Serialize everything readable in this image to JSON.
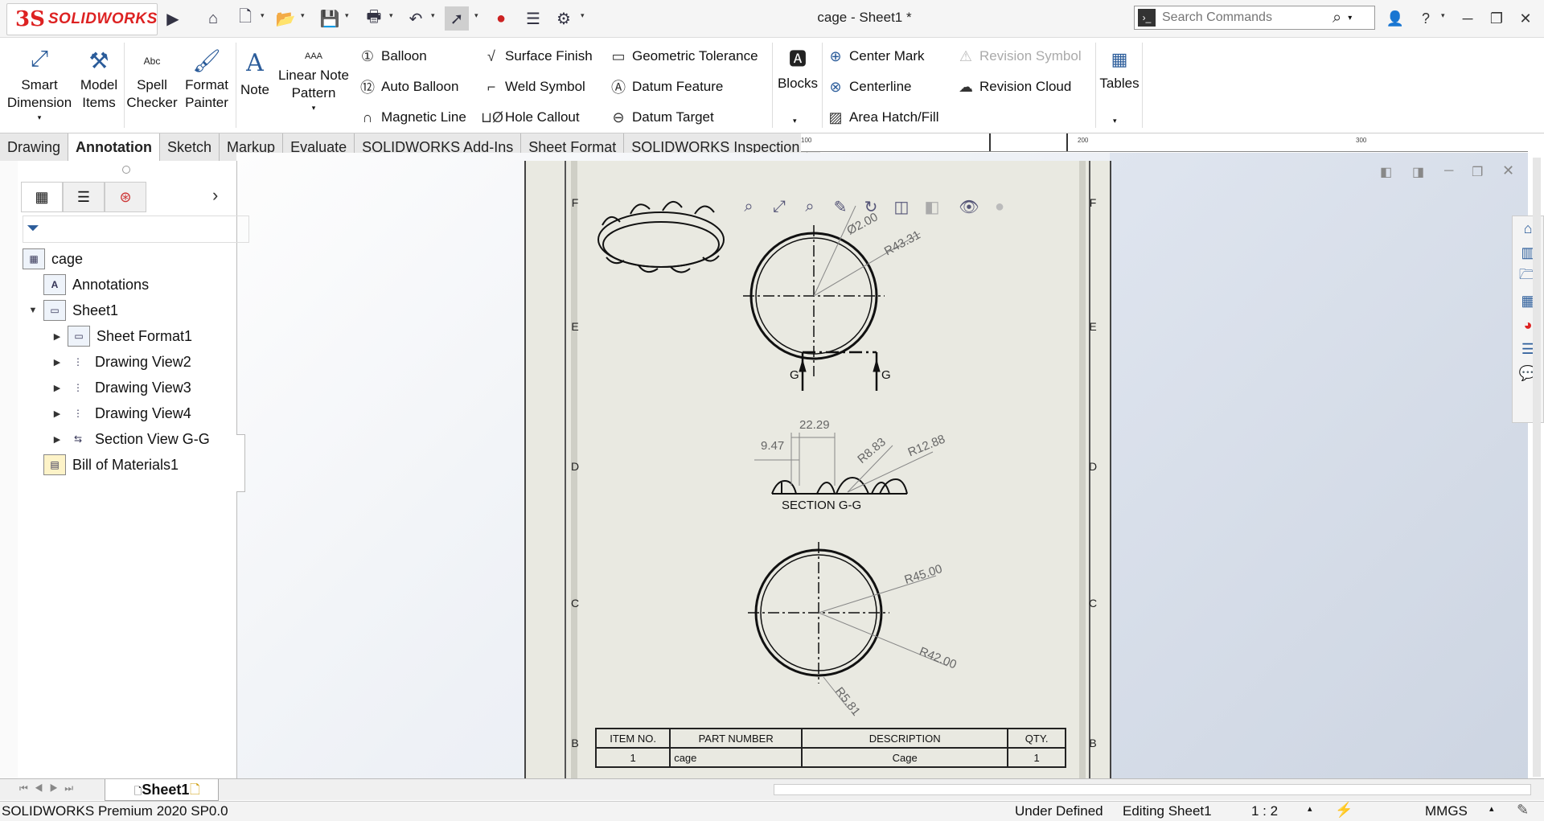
{
  "titlebar": {
    "brand_ds": "3S",
    "brand": "SOLIDWORKS",
    "document_title": "cage - Sheet1 *",
    "search_placeholder": "Search Commands"
  },
  "ribbon": {
    "smart_dimension": [
      "Smart",
      "Dimension"
    ],
    "model_items": [
      "Model",
      "Items"
    ],
    "spell_checker": [
      "Spell",
      "Checker"
    ],
    "format_painter": [
      "Format",
      "Painter"
    ],
    "note": "Note",
    "linear_note_pattern": [
      "Linear Note",
      "Pattern"
    ],
    "balloon": "Balloon",
    "auto_balloon": "Auto Balloon",
    "magnetic_line": "Magnetic Line",
    "surface_finish": "Surface Finish",
    "weld_symbol": "Weld Symbol",
    "hole_callout": "Hole Callout",
    "geometric_tolerance": "Geometric Tolerance",
    "datum_feature": "Datum Feature",
    "datum_target": "Datum Target",
    "blocks": "Blocks",
    "center_mark": "Center Mark",
    "centerline": "Centerline",
    "area_hatch": "Area Hatch/Fill",
    "revision_symbol": "Revision Symbol",
    "revision_cloud": "Revision Cloud",
    "tables": "Tables",
    "spell_abc": "Abc",
    "linear_aaa": "AAA"
  },
  "tabs": [
    "Drawing",
    "Annotation",
    "Sketch",
    "Markup",
    "Evaluate",
    "SOLIDWORKS Add-Ins",
    "Sheet Format",
    "SOLIDWORKS Inspection"
  ],
  "active_tab": "Annotation",
  "ruler_labels": [
    "100",
    "200",
    "300"
  ],
  "tree": {
    "root": "cage",
    "annotations": "Annotations",
    "sheet": "Sheet1",
    "sheet_format": "Sheet Format1",
    "views": [
      "Drawing View2",
      "Drawing View3",
      "Drawing View4",
      "Section View G-G"
    ],
    "bom": "Bill of Materials1"
  },
  "drawing": {
    "zones": [
      "F",
      "E",
      "D",
      "C",
      "B"
    ],
    "dims_top": [
      "Ø2.00",
      "R43.31"
    ],
    "section_marker": "G",
    "dims_section": [
      "22.29",
      "9.47",
      "R8.83",
      "R12.88"
    ],
    "section_label": "SECTION G-G",
    "dims_bottom": [
      "R45.00",
      "R42.00",
      "R5.81"
    ]
  },
  "bom": {
    "headers": [
      "ITEM NO.",
      "PART NUMBER",
      "DESCRIPTION",
      "QTY."
    ],
    "rows": [
      [
        "1",
        "cage",
        "Cage",
        "1"
      ]
    ]
  },
  "sheetbar": {
    "active_sheet": "Sheet1"
  },
  "status": {
    "product": "SOLIDWORKS Premium 2020 SP0.0",
    "definition": "Under Defined",
    "editing": "Editing Sheet1",
    "scale": "1 : 2",
    "units": "MMGS"
  },
  "colors": {
    "brand_red": "#d22222",
    "sheet_bg": "#e9e9e1",
    "ribbon_icon_blue": "#2b5c9a"
  }
}
